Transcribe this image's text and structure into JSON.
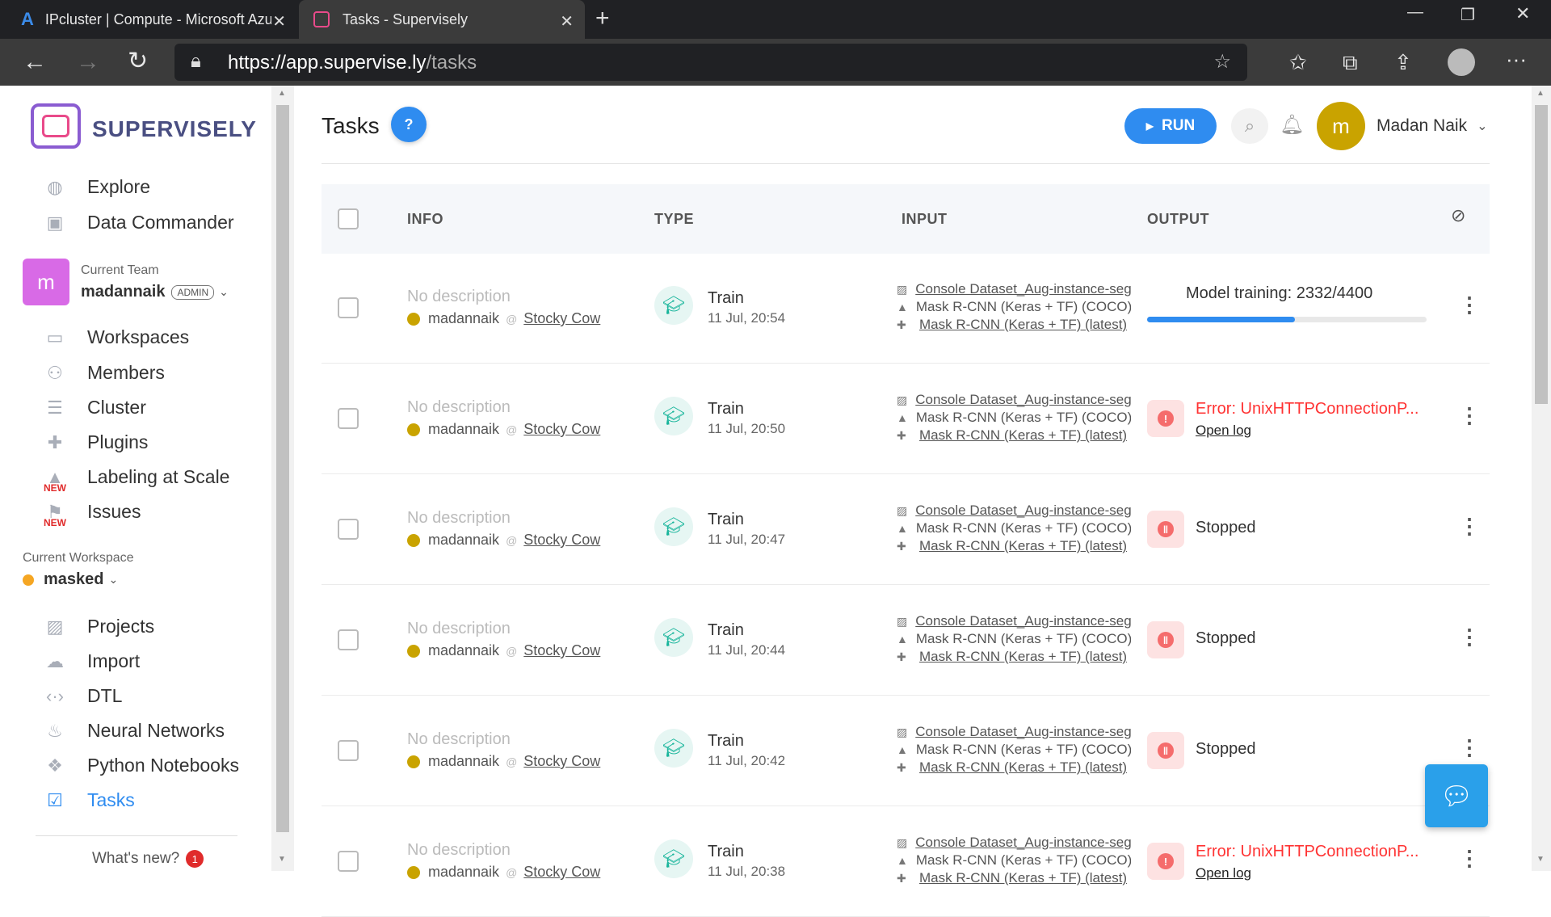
{
  "browser": {
    "tabs": [
      {
        "title": "IPcluster | Compute - Microsoft Azure",
        "close": "✕"
      },
      {
        "title": "Tasks - Supervisely",
        "close": "✕"
      }
    ],
    "url_host": "https://app.supervise.ly",
    "url_path": "/tasks"
  },
  "brand": {
    "name": "SUPERVISELY"
  },
  "nav_top": [
    {
      "label": "Explore"
    },
    {
      "label": "Data Commander"
    }
  ],
  "team": {
    "caption": "Current Team",
    "avatar": "m",
    "name": "madannaik",
    "role": "ADMIN"
  },
  "nav_team": [
    {
      "label": "Workspaces"
    },
    {
      "label": "Members"
    },
    {
      "label": "Cluster"
    },
    {
      "label": "Plugins"
    },
    {
      "label": "Labeling at Scale",
      "tag": "NEW"
    },
    {
      "label": "Issues",
      "tag": "NEW"
    }
  ],
  "workspace": {
    "caption": "Current Workspace",
    "name": "masked",
    "color": "#f5a623"
  },
  "nav_ws": [
    {
      "label": "Projects"
    },
    {
      "label": "Import"
    },
    {
      "label": "DTL"
    },
    {
      "label": "Neural Networks"
    },
    {
      "label": "Python Notebooks"
    },
    {
      "label": "Tasks"
    }
  ],
  "whats_new": {
    "label": "What's new?",
    "count": "1"
  },
  "header": {
    "title": "Tasks",
    "help": "?",
    "run_label": "RUN",
    "user_avatar": "m",
    "user_name": "Madan Naik"
  },
  "table": {
    "columns": [
      "INFO",
      "TYPE",
      "INPUT",
      "OUTPUT"
    ],
    "rows": [
      {
        "desc": "No description",
        "user": "madannaik",
        "node": "Stocky Cow",
        "type": "Train",
        "date": "11 Jul, 20:54",
        "inputs": [
          "Console Dataset_Aug-instance-segmentation",
          "Mask R-CNN (Keras + TF) (COCO)",
          "Mask R-CNN (Keras + TF) (latest)"
        ],
        "status": "progress",
        "status_text": "Model training: 2332/4400",
        "progress": 0.53
      },
      {
        "desc": "No description",
        "user": "madannaik",
        "node": "Stocky Cow",
        "type": "Train",
        "date": "11 Jul, 20:50",
        "inputs": [
          "Console Dataset_Aug-instance-segmentation",
          "Mask R-CNN (Keras + TF) (COCO)",
          "Mask R-CNN (Keras + TF) (latest)"
        ],
        "status": "error",
        "status_text": "Error: UnixHTTPConnectionP...",
        "link": "Open log"
      },
      {
        "desc": "No description",
        "user": "madannaik",
        "node": "Stocky Cow",
        "type": "Train",
        "date": "11 Jul, 20:47",
        "inputs": [
          "Console Dataset_Aug-instance-segmentation",
          "Mask R-CNN (Keras + TF) (COCO)",
          "Mask R-CNN (Keras + TF) (latest)"
        ],
        "status": "stopped",
        "status_text": "Stopped"
      },
      {
        "desc": "No description",
        "user": "madannaik",
        "node": "Stocky Cow",
        "type": "Train",
        "date": "11 Jul, 20:44",
        "inputs": [
          "Console Dataset_Aug-instance-segmentation",
          "Mask R-CNN (Keras + TF) (COCO)",
          "Mask R-CNN (Keras + TF) (latest)"
        ],
        "status": "stopped",
        "status_text": "Stopped"
      },
      {
        "desc": "No description",
        "user": "madannaik",
        "node": "Stocky Cow",
        "type": "Train",
        "date": "11 Jul, 20:42",
        "inputs": [
          "Console Dataset_Aug-instance-segmentation",
          "Mask R-CNN (Keras + TF) (COCO)",
          "Mask R-CNN (Keras + TF) (latest)"
        ],
        "status": "stopped",
        "status_text": "Stopped"
      },
      {
        "desc": "No description",
        "user": "madannaik",
        "node": "Stocky Cow",
        "type": "Train",
        "date": "11 Jul, 20:38",
        "inputs": [
          "Console Dataset_Aug-instance-segmentation",
          "Mask R-CNN (Keras + TF) (COCO)",
          "Mask R-CNN (Keras + TF) (latest)"
        ],
        "status": "error",
        "status_text": "Error: UnixHTTPConnectionP...",
        "link": "Open log"
      }
    ]
  },
  "colors": {
    "accent": "#2f8cf0",
    "error": "#ff3333",
    "stop": "#f56c6c",
    "train": "#18b59b",
    "user_dot": "#c9a300"
  }
}
